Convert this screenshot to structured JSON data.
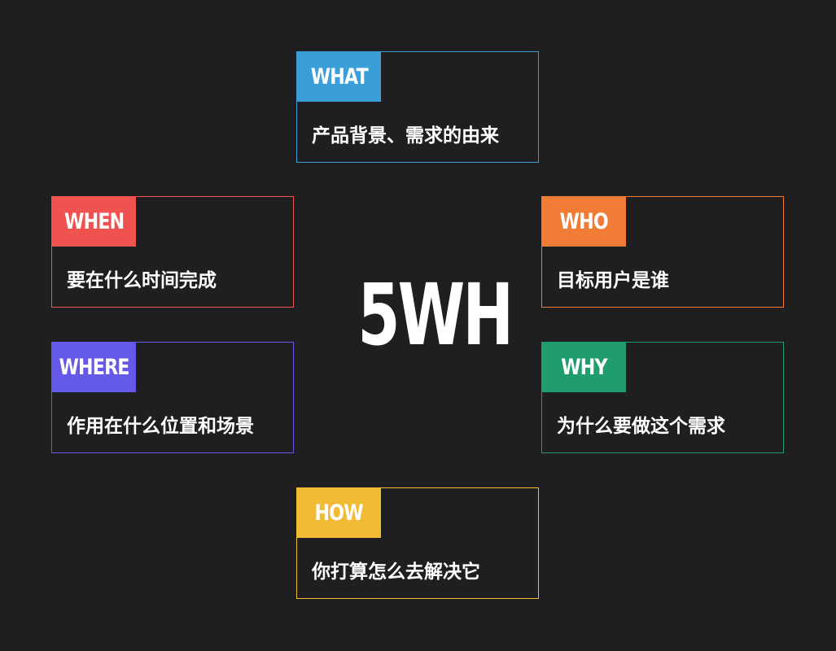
{
  "title": "5WH",
  "cards": {
    "what": {
      "label": "WHAT",
      "text": "产品背景、需求的由来",
      "color": "#3a9fd8"
    },
    "when": {
      "label": "WHEN",
      "text": "要在什么时间完成",
      "color": "#f0524f"
    },
    "who": {
      "label": "WHO",
      "text": "目标用户是谁",
      "color": "#f07c35"
    },
    "where": {
      "label": "WHERE",
      "text": "作用在什么位置和场景",
      "color": "#6559e8"
    },
    "why": {
      "label": "WHY",
      "text": "为什么要做这个需求",
      "color": "#1f9d6e"
    },
    "how": {
      "label": "HOW",
      "text": "你打算怎么去解决它",
      "color": "#f2bb34"
    }
  }
}
